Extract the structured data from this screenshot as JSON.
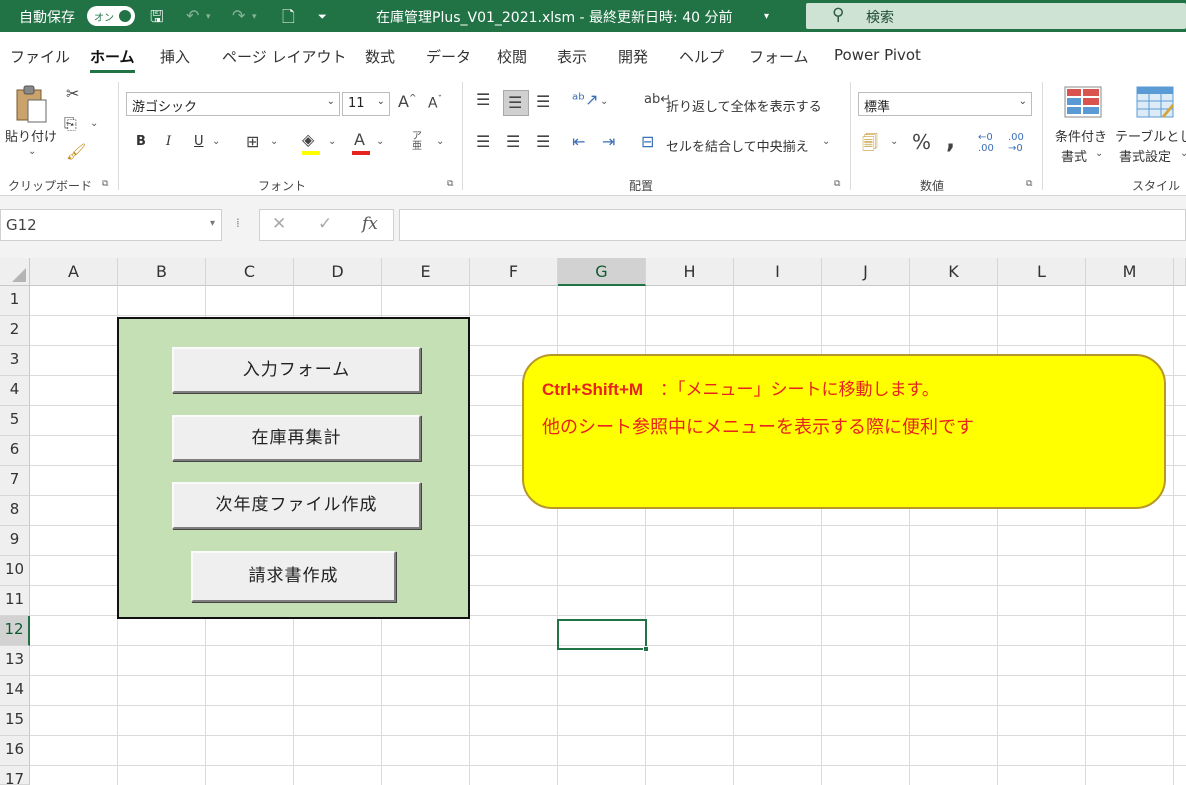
{
  "titlebar": {
    "autosave_label": "自動保存",
    "autosave_state": "オン",
    "doc_title": "在庫管理Plus_V01_2021.xlsm - 最終更新日時: 40 分前",
    "search_label": "検索",
    "accent": "#217346"
  },
  "tabs": [
    "ファイル",
    "ホーム",
    "挿入",
    "ページ レイアウト",
    "数式",
    "データ",
    "校閲",
    "表示",
    "開発",
    "ヘルプ",
    "フォーム",
    "Power Pivot"
  ],
  "active_tab": "ホーム",
  "ribbon": {
    "clipboard": {
      "paste_label": "貼り付け",
      "group_label": "クリップボード"
    },
    "font": {
      "font_name": "游ゴシック",
      "font_size": "11",
      "bold": "B",
      "italic": "I",
      "underline": "U",
      "group_label": "フォント"
    },
    "alignment": {
      "wrap_text": "折り返して全体を表示する",
      "merge_center": "セルを結合して中央揃え",
      "group_label": "配置"
    },
    "number": {
      "format": "標準",
      "percent": "%",
      "comma": ",",
      "group_label": "数値"
    },
    "styles": {
      "conditional_l1": "条件付き",
      "conditional_l2": "書式",
      "table_l1": "テーブルとして",
      "table_l2": "書式設定",
      "group_label": "スタイル"
    }
  },
  "formula_bar": {
    "name_box": "G12",
    "formula": ""
  },
  "grid": {
    "columns": [
      "A",
      "B",
      "C",
      "D",
      "E",
      "F",
      "G",
      "H",
      "I",
      "J",
      "K",
      "L",
      "M"
    ],
    "rows": [
      "1",
      "2",
      "3",
      "4",
      "5",
      "6",
      "7",
      "8",
      "9",
      "10",
      "11",
      "12",
      "13",
      "14",
      "15",
      "16",
      "17"
    ],
    "selected_column": "G",
    "selected_row": "12"
  },
  "menu_panel": {
    "background": "#c5e0b4",
    "buttons": [
      "入力フォーム",
      "在庫再集計",
      "次年度ファイル作成",
      "請求書作成"
    ]
  },
  "callout": {
    "shortcut": "Ctrl+Shift+M",
    "line1_rest": "　：「メニュー」シートに移動します。",
    "line2": "他のシート参照中にメニューを表示する際に便利です",
    "background": "#ffff00",
    "text_color": "#e8221e"
  }
}
